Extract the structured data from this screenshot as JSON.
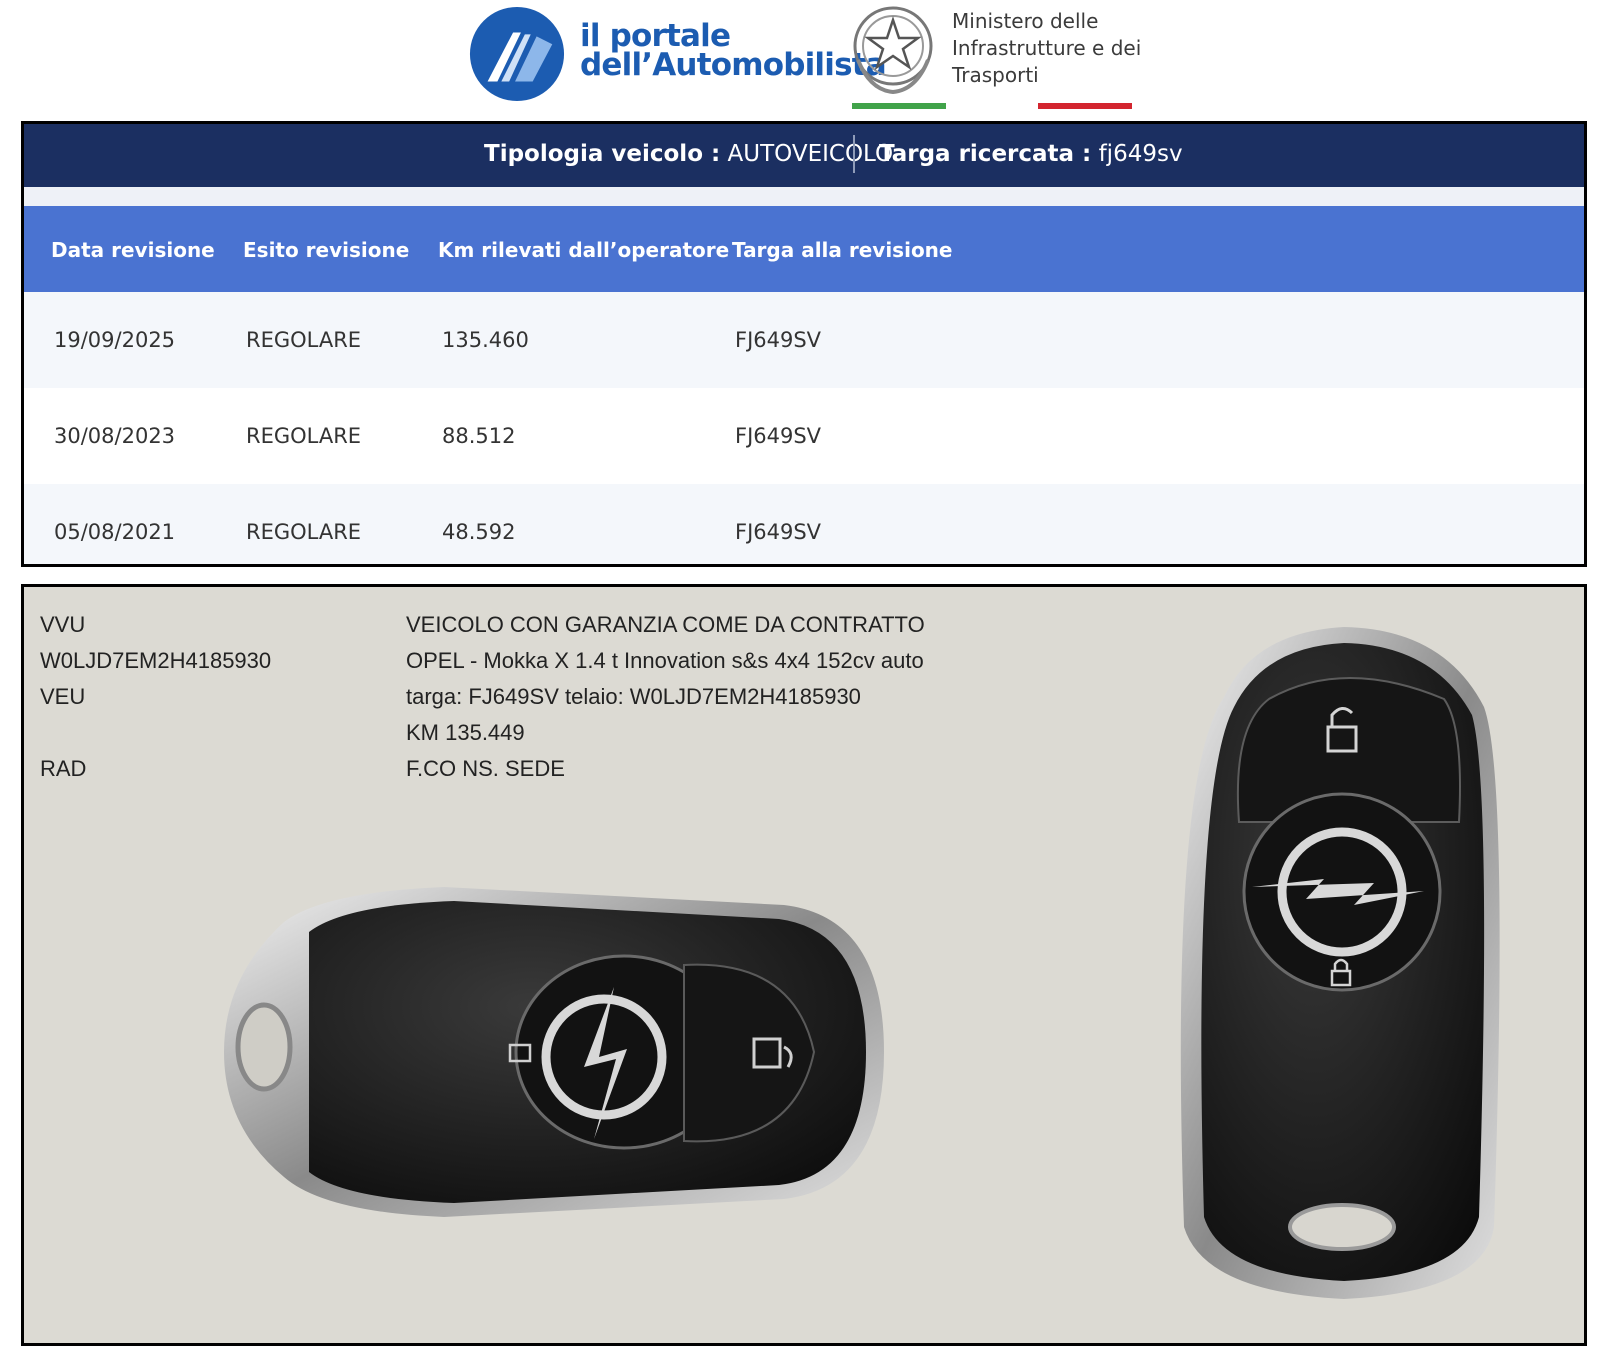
{
  "header": {
    "portal_line1": "il portale",
    "portal_line2": "dell’Automobilista",
    "ministry_line1": "Ministero delle",
    "ministry_line2": "Infrastrutture e dei",
    "ministry_line3": "Trasporti",
    "colors": {
      "portal_blue": "#1c5cb1",
      "flag_green": "#41a34a",
      "flag_red": "#d3252f"
    }
  },
  "search": {
    "vehicle_type_label": "Tipologia veicolo :",
    "vehicle_type_value": "AUTOVEICOLO",
    "plate_label": "Targa ricercata :",
    "plate_value": "fj649sv"
  },
  "table": {
    "columns": [
      "Data revisione",
      "Esito revisione",
      "Km rilevati dall’operatore",
      "Targa alla revisione"
    ],
    "rows": [
      [
        "19/09/2025",
        "REGOLARE",
        "135.460",
        "FJ649SV"
      ],
      [
        "30/08/2023",
        "REGOLARE",
        "88.512",
        "FJ649SV"
      ],
      [
        "05/08/2021",
        "REGOLARE",
        "48.592",
        "FJ649SV"
      ]
    ],
    "colors": {
      "topbar": "#1b2f61",
      "header_row": "#4a73d1"
    }
  },
  "document": {
    "left_lines": [
      "VVU",
      "W0LJD7EM2H4185930",
      "VEU",
      "RAD"
    ],
    "right_lines": [
      "VEICOLO CON GARANZIA COME DA CONTRATTO",
      "OPEL - Mokka X 1.4 t Innovation s&s 4x4 152cv auto",
      "targa: FJ649SV telaio: W0LJD7EM2H4185930",
      "KM 135.449",
      "F.CO NS. SEDE"
    ]
  },
  "photo": {
    "objects": [
      "car-key-fob-horizontal",
      "car-key-fob-vertical"
    ],
    "icons": [
      "unlock-icon",
      "lock-icon",
      "trunk-icon",
      "opel-logo"
    ]
  }
}
